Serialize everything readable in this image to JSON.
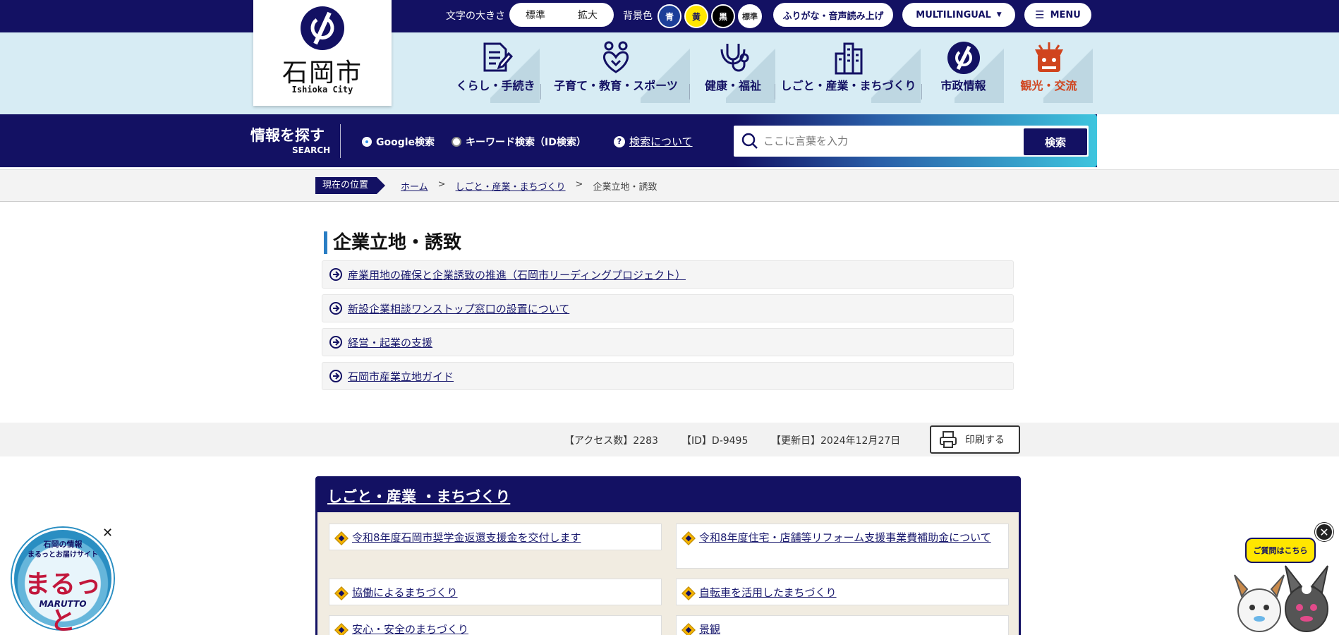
{
  "header": {
    "font_size_label": "文字の大きさ",
    "font_size_options": [
      "標準",
      "拡大"
    ],
    "bg_color_label": "背景色",
    "bg_colors": [
      {
        "label": "青",
        "bg": "#1c3e99",
        "fg": "#ffffff"
      },
      {
        "label": "黄",
        "bg": "#ffe600",
        "fg": "#131163"
      },
      {
        "label": "黒",
        "bg": "#000000",
        "fg": "#ffffff"
      },
      {
        "label": "標準",
        "bg": "#ffffff",
        "fg": "#333333"
      }
    ],
    "furigana_label": "ふりがな・音声読み上げ",
    "multilingual_label": "MULTILINGUAL",
    "menu_label": "MENU",
    "accent_color": "#131163"
  },
  "logo": {
    "name": "石岡市",
    "name_en": "Ishioka City"
  },
  "nav": {
    "items": [
      {
        "label": "くらし・手続き",
        "icon": "document-pen-icon"
      },
      {
        "label": "子育て・教育・スポーツ",
        "icon": "family-heart-icon"
      },
      {
        "label": "健康・福祉",
        "icon": "stethoscope-icon"
      },
      {
        "label": "しごと・産業・まちづくり",
        "icon": "buildings-icon"
      },
      {
        "label": "市政情報",
        "icon": "city-emblem-icon"
      },
      {
        "label": "観光・交流",
        "icon": "lion-mask-icon"
      }
    ],
    "highlight_color": "#d0441e"
  },
  "search": {
    "title": "情報を探す",
    "subtitle": "SEARCH",
    "option_google": "Google検索",
    "option_keyword": "キーワード検索（ID検索）",
    "help_label": "検索について",
    "placeholder": "ここに言葉を入力",
    "button_label": "検索"
  },
  "breadcrumb": {
    "here_label": "現在の位置",
    "items": [
      "ホーム",
      "しごと・産業・まちづくり",
      "企業立地・誘致"
    ],
    "separator": ">"
  },
  "main": {
    "title": "企業立地・誘致",
    "links": [
      "産業用地の確保と企業誘致の推進（石岡市リーディングプロジェクト）",
      "新設企業相談ワンストップ窓口の設置について",
      "経営・起業の支援",
      "石岡市産業立地ガイド"
    ]
  },
  "page_info": {
    "access": "【アクセス数】2283",
    "id": "【ID】D-9495",
    "updated": "【更新日】2024年12月27日",
    "print_label": "印刷する"
  },
  "category": {
    "title": "しごと・産業 ・まちづくり",
    "items": [
      "令和8年度石岡市奨学金返還支援金を交付します",
      "令和8年度住宅・店舗等リフォーム支援事業費補助金について",
      "協働によるまちづくり",
      "自転車を活用したまちづくり",
      "安心・安全のまちづくり",
      "景観"
    ]
  },
  "widgets": {
    "maruto_line1": "石岡の情報",
    "maruto_line2": "まるっとお届けサイト",
    "maruto_big": "まるっと",
    "maruto_en": "MARUTTO",
    "close_symbol": "✕",
    "chat_label": "ご質問はこちら"
  }
}
